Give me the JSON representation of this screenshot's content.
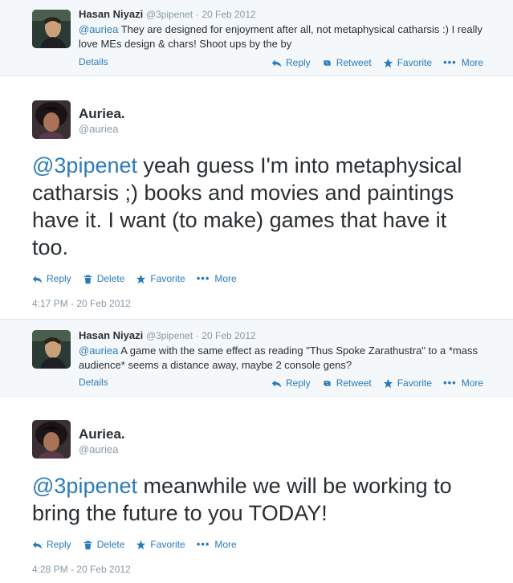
{
  "tweets": [
    {
      "kind": "reply",
      "name": "Hasan Niyazi",
      "handle": "@3pipenet",
      "date": "20 Feb 2012",
      "mention": "@auriea",
      "text": " They are designed for enjoyment after all, not metaphysical catharsis :) I really love MEs design & chars! Shoot ups by the by",
      "details": "Details",
      "actions": [
        "Reply",
        "Retweet",
        "Favorite",
        "More"
      ]
    },
    {
      "kind": "main",
      "name": "Auriea.",
      "handle": "@auriea",
      "mention": "@3pipenet",
      "text": " yeah guess I'm into metaphysical catharsis ;) books and movies and paintings have it. I want (to make) games that have it too.",
      "actions": [
        "Reply",
        "Delete",
        "Favorite",
        "More"
      ],
      "time": "4:17 PM - 20 Feb 2012"
    },
    {
      "kind": "reply",
      "name": "Hasan Niyazi",
      "handle": "@3pipenet",
      "date": "20 Feb 2012",
      "mention": "@auriea",
      "text": " A game with the same effect as reading \"Thus Spoke Zarathustra\" to a *mass audience* seems a distance away, maybe 2 console gens?",
      "details": "Details",
      "actions": [
        "Reply",
        "Retweet",
        "Favorite",
        "More"
      ]
    },
    {
      "kind": "main",
      "name": "Auriea.",
      "handle": "@auriea",
      "mention": "@3pipenet",
      "text": " meanwhile we will be working to bring the future to you TODAY!",
      "actions": [
        "Reply",
        "Delete",
        "Favorite",
        "More"
      ],
      "time": "4:28 PM - 20 Feb 2012"
    }
  ],
  "colors": {
    "link": "#2b7bb9",
    "muted": "#8899a6",
    "text": "#292f33",
    "reply_bg": "#f5f8fa"
  },
  "icons": {
    "reply": "reply-arrow-icon",
    "retweet": "retweet-icon",
    "favorite": "star-icon",
    "delete": "trash-icon",
    "more": "more-dots-icon"
  }
}
